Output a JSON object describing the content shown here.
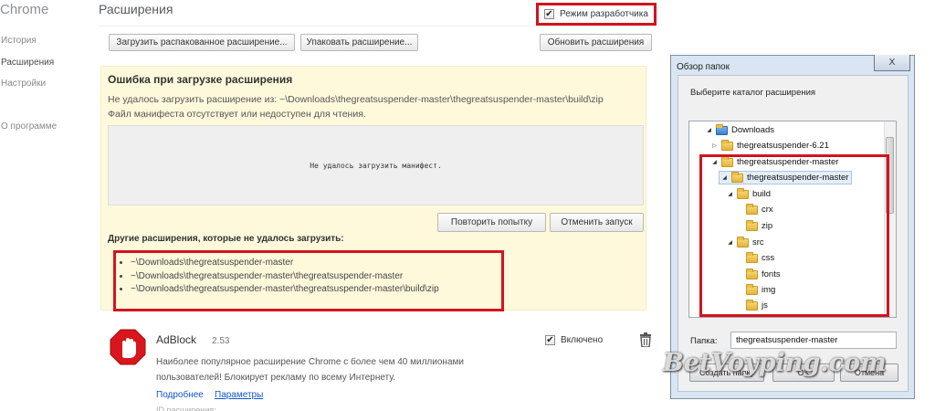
{
  "sidebar": {
    "brand": "Chrome",
    "items": [
      "История",
      "Расширения",
      "Настройки",
      "О программе"
    ]
  },
  "header": {
    "title": "Расширения",
    "dev_mode_label": "Режим разработчика",
    "dev_mode_checked": true
  },
  "toolbar": {
    "load_unpacked": "Загрузить распакованное расширение...",
    "pack": "Упаковать расширение...",
    "update": "Обновить расширения"
  },
  "error": {
    "title": "Ошибка при загрузке расширения",
    "line1": "Не удалось загрузить расширение из: ~\\Downloads\\thegreatsuspender-master\\thegreatsuspender-master\\build\\zip",
    "line2": "Файл манифеста отсутствует или недоступен для чтения.",
    "manifest_msg": "Не удалось загрузить манифест.",
    "retry": "Повторить попытку",
    "cancel": "Отменить запуск",
    "others_title": "Другие расширения, которые не удалось загрузить:",
    "others": [
      "~\\Downloads\\thegreatsuspender-master",
      "~\\Downloads\\thegreatsuspender-master\\thegreatsuspender-master",
      "~\\Downloads\\thegreatsuspender-master\\thegreatsuspender-master\\build\\zip"
    ]
  },
  "adblock": {
    "name": "AdBlock",
    "version": "2.53",
    "desc1": "Наиболее популярное расширение Chrome с более чем 40 миллионами",
    "desc2": "пользователей! Блокирует рекламу по всему Интернету.",
    "details_link": "Подробнее",
    "options_link": "Параметры",
    "enabled_label": "Включено",
    "enabled": true
  },
  "dialog": {
    "title": "Обзор папок",
    "close": "X",
    "prompt": "Выберите каталог расширения",
    "tree": [
      {
        "label": "Downloads",
        "expander": "◢",
        "icon": "downloads-folder-icon"
      },
      {
        "label": "thegreatsuspender-6.21",
        "expander": "▷",
        "icon": "folder-icon"
      },
      {
        "label": "thegreatsuspender-master",
        "expander": "◢",
        "icon": "folder-icon"
      },
      {
        "label": "thegreatsuspender-master",
        "expander": "◢",
        "icon": "folder-icon",
        "selected": true
      },
      {
        "label": "build",
        "expander": "◢",
        "icon": "folder-icon"
      },
      {
        "label": "crx",
        "expander": "",
        "icon": "folder-icon"
      },
      {
        "label": "zip",
        "expander": "",
        "icon": "folder-icon"
      },
      {
        "label": "src",
        "expander": "◢",
        "icon": "folder-icon"
      },
      {
        "label": "css",
        "expander": "",
        "icon": "folder-icon"
      },
      {
        "label": "fonts",
        "expander": "",
        "icon": "folder-icon"
      },
      {
        "label": "img",
        "expander": "",
        "icon": "folder-icon"
      },
      {
        "label": "js",
        "expander": "",
        "icon": "folder-icon"
      }
    ],
    "folder_label": "Папка:",
    "folder_value": "thegreatsuspender-master",
    "new_folder": "Создать папку",
    "ok": "OK",
    "cancel": "Отмена"
  },
  "watermark": "BetVoyping.com",
  "colors": {
    "highlight_red": "#d2141e",
    "error_bg": "#fff9dc",
    "link": "#1155cc"
  }
}
